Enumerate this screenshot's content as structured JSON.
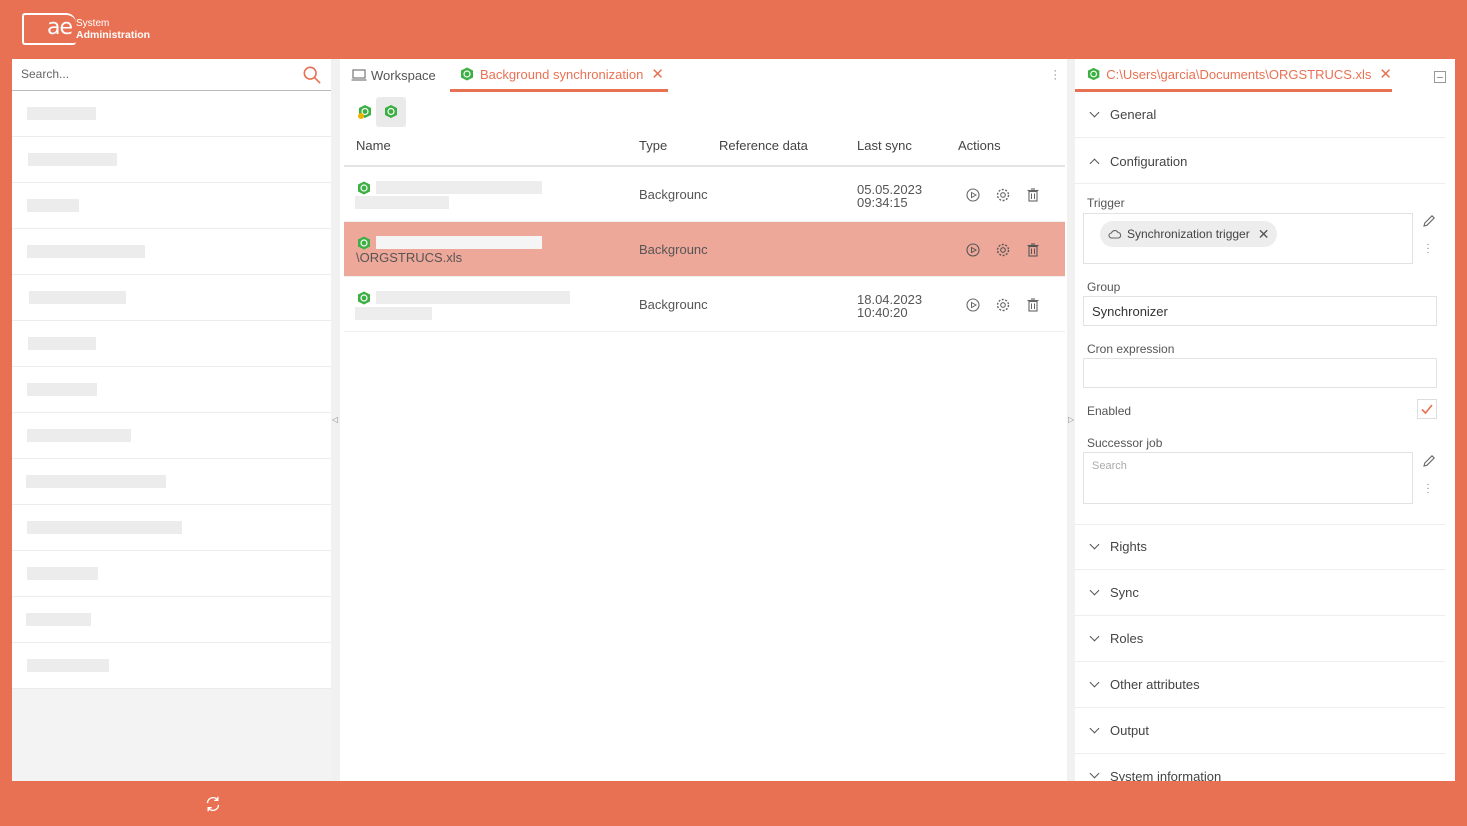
{
  "app": {
    "logo_text": "ae",
    "logo_line1": "System",
    "logo_line2": "Administration"
  },
  "left_panel": {
    "search_placeholder": "Search..."
  },
  "middle": {
    "tabs": [
      {
        "label": "Workspace"
      },
      {
        "label": "Background synchronization"
      }
    ],
    "columns": [
      "Name",
      "Type",
      "Reference data",
      "Last sync",
      "Actions"
    ],
    "rows": [
      {
        "name": "",
        "type": "Backgrounc",
        "last_sync_date": "05.05.2023",
        "last_sync_time": "09:34:15",
        "selected": false
      },
      {
        "name": "\\ORGSTRUCS.xls",
        "type": "Backgrounc",
        "last_sync_date": "",
        "last_sync_time": "",
        "selected": true
      },
      {
        "name": "",
        "type": "Backgrounc",
        "last_sync_date": "18.04.2023",
        "last_sync_time": "10:40:20",
        "selected": false
      }
    ]
  },
  "right": {
    "tab_label": "C:\\Users\\garcia\\Documents\\ORGSTRUCS.xls",
    "sections": {
      "general": "General",
      "configuration": "Configuration",
      "rights": "Rights",
      "sync": "Sync",
      "roles": "Roles",
      "other": "Other attributes",
      "output": "Output",
      "system": "System information"
    },
    "fields": {
      "trigger_label": "Trigger",
      "trigger_chip": "Synchronization trigger",
      "group_label": "Group",
      "group_value": "Synchronizer",
      "cron_label": "Cron expression",
      "cron_value": "",
      "enabled_label": "Enabled",
      "enabled": true,
      "successor_label": "Successor job",
      "successor_placeholder": "Search"
    }
  },
  "colors": {
    "accent": "#e97153",
    "selected_row": "#eea89a",
    "icon_green": "#3cb043"
  }
}
